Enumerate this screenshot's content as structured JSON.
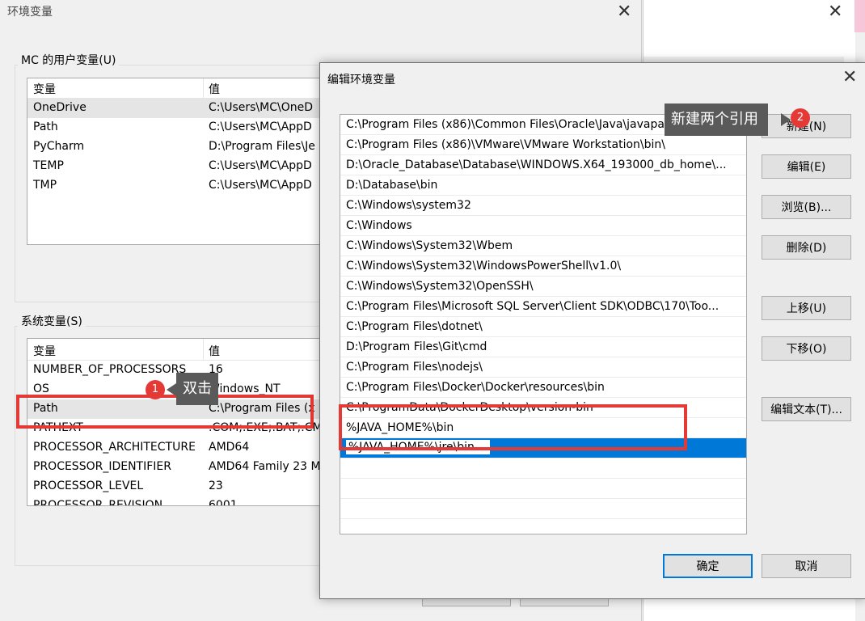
{
  "env_window": {
    "title": "环境变量",
    "user_group_label": "MC 的用户变量(U)",
    "col_var": "变量",
    "col_val": "值",
    "user_vars": [
      {
        "name": "OneDrive",
        "value": "C:\\Users\\MC\\OneD"
      },
      {
        "name": "Path",
        "value": "C:\\Users\\MC\\AppD"
      },
      {
        "name": "PyCharm",
        "value": "D:\\Program Files\\Je"
      },
      {
        "name": "TEMP",
        "value": "C:\\Users\\MC\\AppD"
      },
      {
        "name": "TMP",
        "value": "C:\\Users\\MC\\AppD"
      }
    ],
    "system_group_label": "系统变量(S)",
    "system_vars": [
      {
        "name": "NUMBER_OF_PROCESSORS",
        "value": "16"
      },
      {
        "name": "OS",
        "value": "Windows_NT"
      },
      {
        "name": "Path",
        "value": "C:\\Program Files (x"
      },
      {
        "name": "PATHEXT",
        "value": ".COM;.EXE;.BAT;.CM"
      },
      {
        "name": "PROCESSOR_ARCHITECTURE",
        "value": "AMD64"
      },
      {
        "name": "PROCESSOR_IDENTIFIER",
        "value": "AMD64 Family 23 M"
      },
      {
        "name": "PROCESSOR_LEVEL",
        "value": "23"
      },
      {
        "name": "PROCESSOR_REVISION",
        "value": "6001"
      }
    ]
  },
  "edit_dialog": {
    "title": "编辑环境变量",
    "paths": [
      "C:\\Program Files (x86)\\Common Files\\Oracle\\Java\\javapath",
      "C:\\Program Files (x86)\\VMware\\VMware Workstation\\bin\\",
      "D:\\Oracle_Database\\Database\\WINDOWS.X64_193000_db_home\\...",
      "D:\\Database\\bin",
      "C:\\Windows\\system32",
      "C:\\Windows",
      "C:\\Windows\\System32\\Wbem",
      "C:\\Windows\\System32\\WindowsPowerShell\\v1.0\\",
      "C:\\Windows\\System32\\OpenSSH\\",
      "C:\\Program Files\\Microsoft SQL Server\\Client SDK\\ODBC\\170\\Too...",
      "C:\\Program Files\\dotnet\\",
      "D:\\Program Files\\Git\\cmd",
      "C:\\Program Files\\nodejs\\",
      "C:\\Program Files\\Docker\\Docker\\resources\\bin",
      "C:\\ProgramData\\DockerDesktop\\version-bin",
      "%JAVA_HOME%\\bin"
    ],
    "editing_value": "%JAVA_HOME%\\jre\\bin",
    "buttons": {
      "new": "新建(N)",
      "edit": "编辑(E)",
      "browse": "浏览(B)...",
      "delete": "删除(D)",
      "move_up": "上移(U)",
      "move_down": "下移(O)",
      "edit_text": "编辑文本(T)...",
      "ok": "确定",
      "cancel": "取消"
    }
  },
  "annotations": {
    "step1_number": "1",
    "step1_text": "双击",
    "step2_number": "2",
    "step2_text": "新建两个引用"
  },
  "colors": {
    "selection": "#0078d7",
    "annotation_red": "#e53935",
    "tooltip_bg": "#5a5a5a"
  }
}
